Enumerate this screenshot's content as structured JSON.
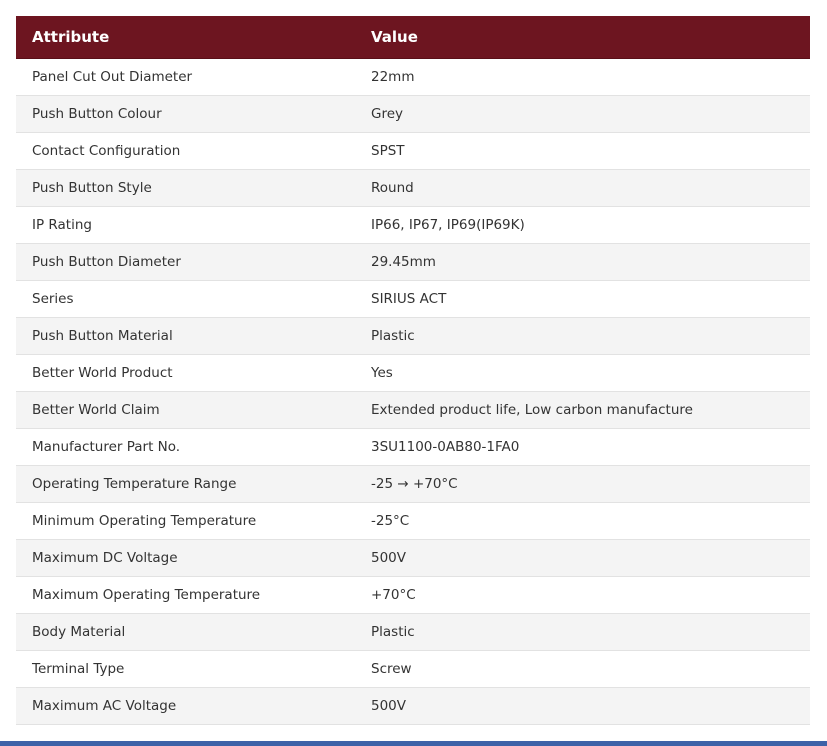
{
  "table": {
    "headers": {
      "attribute": "Attribute",
      "value": "Value"
    },
    "rows": [
      {
        "attribute": "Panel Cut Out Diameter",
        "value": "22mm"
      },
      {
        "attribute": "Push Button Colour",
        "value": "Grey"
      },
      {
        "attribute": "Contact Configuration",
        "value": "SPST"
      },
      {
        "attribute": "Push Button Style",
        "value": "Round"
      },
      {
        "attribute": "IP Rating",
        "value": "IP66, IP67, IP69(IP69K)"
      },
      {
        "attribute": "Push Button Diameter",
        "value": "29.45mm"
      },
      {
        "attribute": "Series",
        "value": "SIRIUS ACT"
      },
      {
        "attribute": "Push Button Material",
        "value": "Plastic"
      },
      {
        "attribute": "Better World Product",
        "value": "Yes"
      },
      {
        "attribute": "Better World Claim",
        "value": "Extended product life, Low carbon manufacture"
      },
      {
        "attribute": "Manufacturer Part No.",
        "value": "3SU1100-0AB80-1FA0"
      },
      {
        "attribute": "Operating Temperature Range",
        "value": "-25 → +70°C"
      },
      {
        "attribute": "Minimum Operating Temperature",
        "value": "-25°C"
      },
      {
        "attribute": "Maximum DC Voltage",
        "value": "500V"
      },
      {
        "attribute": "Maximum Operating Temperature",
        "value": "+70°C"
      },
      {
        "attribute": "Body Material",
        "value": "Plastic"
      },
      {
        "attribute": "Terminal Type",
        "value": "Screw"
      },
      {
        "attribute": "Maximum AC Voltage",
        "value": "500V"
      }
    ]
  },
  "colors": {
    "header_background": "#6d1520",
    "header_text": "#ffffff",
    "row_alt_background": "#f4f4f4",
    "bottom_bar": "#3d62a8"
  }
}
